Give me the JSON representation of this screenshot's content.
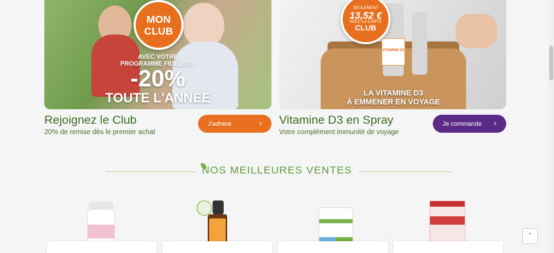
{
  "promos": [
    {
      "badge_line1": "MON",
      "badge_line2": "CLUB",
      "banner_sub1": "AVEC VOTRE",
      "banner_sub2": "PROGRAMME FIDÉLITÉ :",
      "banner_big": "-20%",
      "banner_year": "TOUTE L'ANNÉE",
      "title": "Rejoignez le Club",
      "description": "20% de remise dès le premier achat",
      "button_label": "J'adhère",
      "button_color": "#e76f1e"
    },
    {
      "badge_line1": "SEULEMENT",
      "badge_price": "13,52 €",
      "badge_line3": "AVEC LA CARTE",
      "badge_line4": "CLUB",
      "banner_line1": "LA VITAMINE D3",
      "banner_line2": "À EMMENER EN VOYAGE",
      "bottle_label": "VITAMINE D3",
      "title": "Vitamine D3 en Spray",
      "description": "Votre complément immunité de voyage",
      "button_label": "Je commande",
      "button_color": "#5b2a86"
    }
  ],
  "best_sellers": {
    "title": "NOS MEILLEURES VENTES",
    "accent_color": "#5e9b3a"
  },
  "icons": {
    "chevron": "›",
    "scroll_top": "⌃"
  }
}
